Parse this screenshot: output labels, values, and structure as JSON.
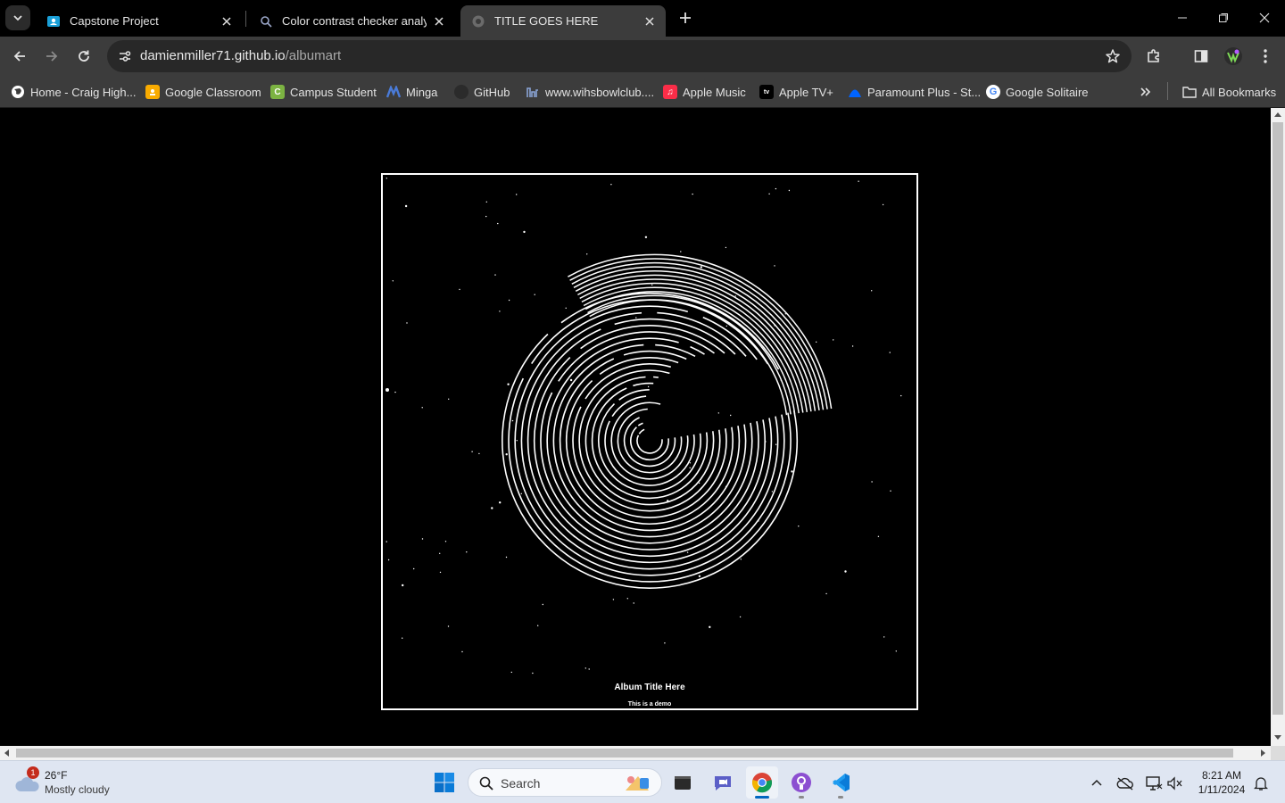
{
  "browser": {
    "tabs": [
      {
        "title": "Capstone Project",
        "favicon": "classroom-icon",
        "active": false
      },
      {
        "title": "Color contrast checker analyzer",
        "favicon": "contrast-checker-icon",
        "active": false
      },
      {
        "title": "TITLE GOES HERE",
        "favicon": "globe-icon",
        "active": true
      }
    ],
    "url_host": "damienmiller71.github.io",
    "url_path": "/albumart",
    "bookmarks": [
      {
        "label": "Home - Craig High...",
        "icon": "globe-icon",
        "color": "#ffffff"
      },
      {
        "label": "Google Classroom",
        "icon": "classroom-icon",
        "color": "#f9ab00"
      },
      {
        "label": "Campus Student",
        "icon": "campus-icon",
        "color": "#7cb342"
      },
      {
        "label": "Minga",
        "icon": "minga-icon",
        "color": "#4a7bd8"
      },
      {
        "label": "GitHub",
        "icon": "github-icon",
        "color": "#2b2b2b"
      },
      {
        "label": "www.wihsbowlclub....",
        "icon": "bowl-club-icon",
        "color": "#8aa4d6"
      },
      {
        "label": "Apple Music",
        "icon": "apple-music-icon",
        "color": "#fa2d48"
      },
      {
        "label": "Apple TV+",
        "icon": "apple-tv-icon",
        "color": "#000000"
      },
      {
        "label": "Paramount Plus - St...",
        "icon": "paramount-icon",
        "color": "#0064ff"
      },
      {
        "label": "Google Solitaire",
        "icon": "google-icon",
        "color": "#ffffff"
      }
    ],
    "all_bookmarks": "All Bookmarks"
  },
  "album": {
    "title": "Album Title Here",
    "subtitle": "This is a demo"
  },
  "taskbar": {
    "weather_temp": "26°F",
    "weather_cond": "Mostly cloudy",
    "weather_badge": "1",
    "search_label": "Search",
    "time": "8:21 AM",
    "date": "1/11/2024"
  },
  "colors": {
    "accent_blue": "#0067c0",
    "chrome_dark": "#3c3c3c"
  }
}
